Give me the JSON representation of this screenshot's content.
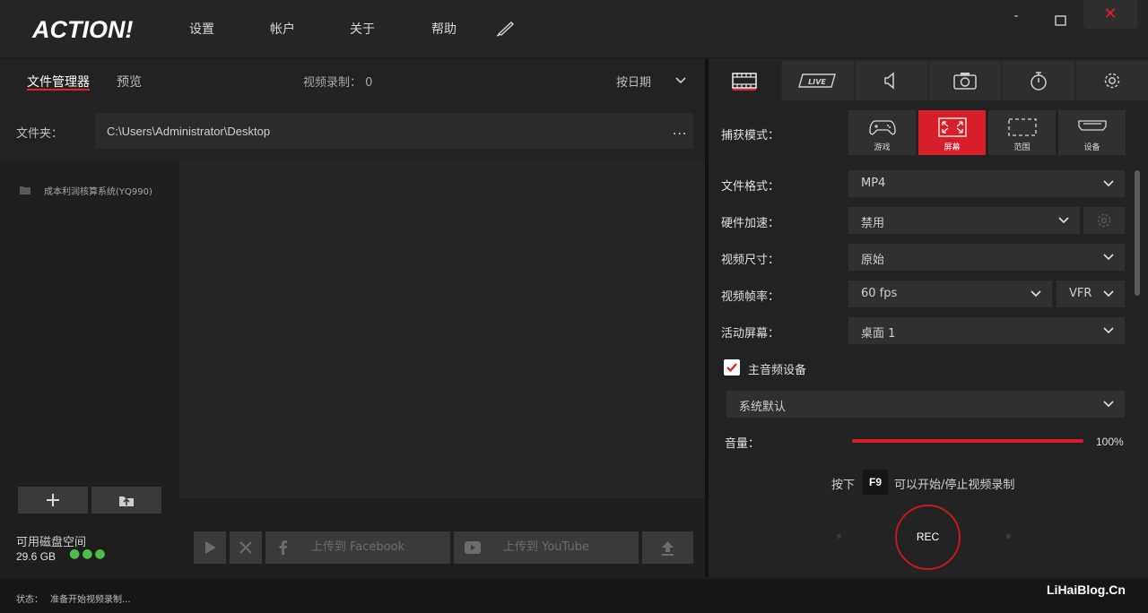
{
  "app": {
    "logo": "ACTION!",
    "menu": [
      "设置",
      "帐户",
      "关于",
      "帮助"
    ],
    "window_controls": {
      "minimize": "-",
      "close": "✕"
    }
  },
  "left": {
    "tabs": {
      "files": "文件管理器",
      "preview": "预览"
    },
    "recordings_count_label": "视频录制： 0",
    "sort_label": "按日期",
    "folder_label": "文件夹：",
    "folder_path": "C:\\Users\\Administrator\\Desktop",
    "folder_more": "...",
    "tree_items": [
      {
        "label": "成本利润核算系统(YQ990)"
      }
    ],
    "disk": {
      "label": "可用磁盘空间",
      "size": "29.6 GB",
      "dots": "●●●"
    },
    "actions": {
      "facebook": "上传到 Facebook",
      "youtube": "上传到 YouTube"
    }
  },
  "right": {
    "tabs": [
      "video-icon",
      "live-icon",
      "audio-icon",
      "camera-icon",
      "timer-icon",
      "gear-icon"
    ],
    "capture_label": "捕获模式：",
    "capture_modes": [
      "游戏",
      "屏幕",
      "范围",
      "设备"
    ],
    "active_capture_mode": "屏幕",
    "settings": {
      "format_label": "文件格式：",
      "format_value": "MP4",
      "hw_label": "硬件加速：",
      "hw_value": "禁用",
      "size_label": "视频尺寸：",
      "size_value": "原始",
      "fps_label": "视频帧率：",
      "fps_value": "60 fps",
      "fps_mode": "VFR",
      "screen_label": "活动屏幕：",
      "screen_value": "桌面 1"
    },
    "audio": {
      "checkbox_label": "主音频设备",
      "checked": true,
      "device_value": "系统默认",
      "volume_label": "音量：",
      "volume_value": "100%",
      "volume_level": 1.0
    },
    "hint": {
      "press": "按下",
      "hotkey": "F9",
      "rest": "可以开始/停止视频录制"
    },
    "rec_button": "REC"
  },
  "status": {
    "label": "状态：",
    "text": "准备开始视频录制..."
  },
  "watermark": "LiHaiBlog.Cn",
  "colors": {
    "accent": "#d71f29",
    "bg": "#222222",
    "panel": "#303030",
    "disk_ok": "#4bbd4a"
  }
}
